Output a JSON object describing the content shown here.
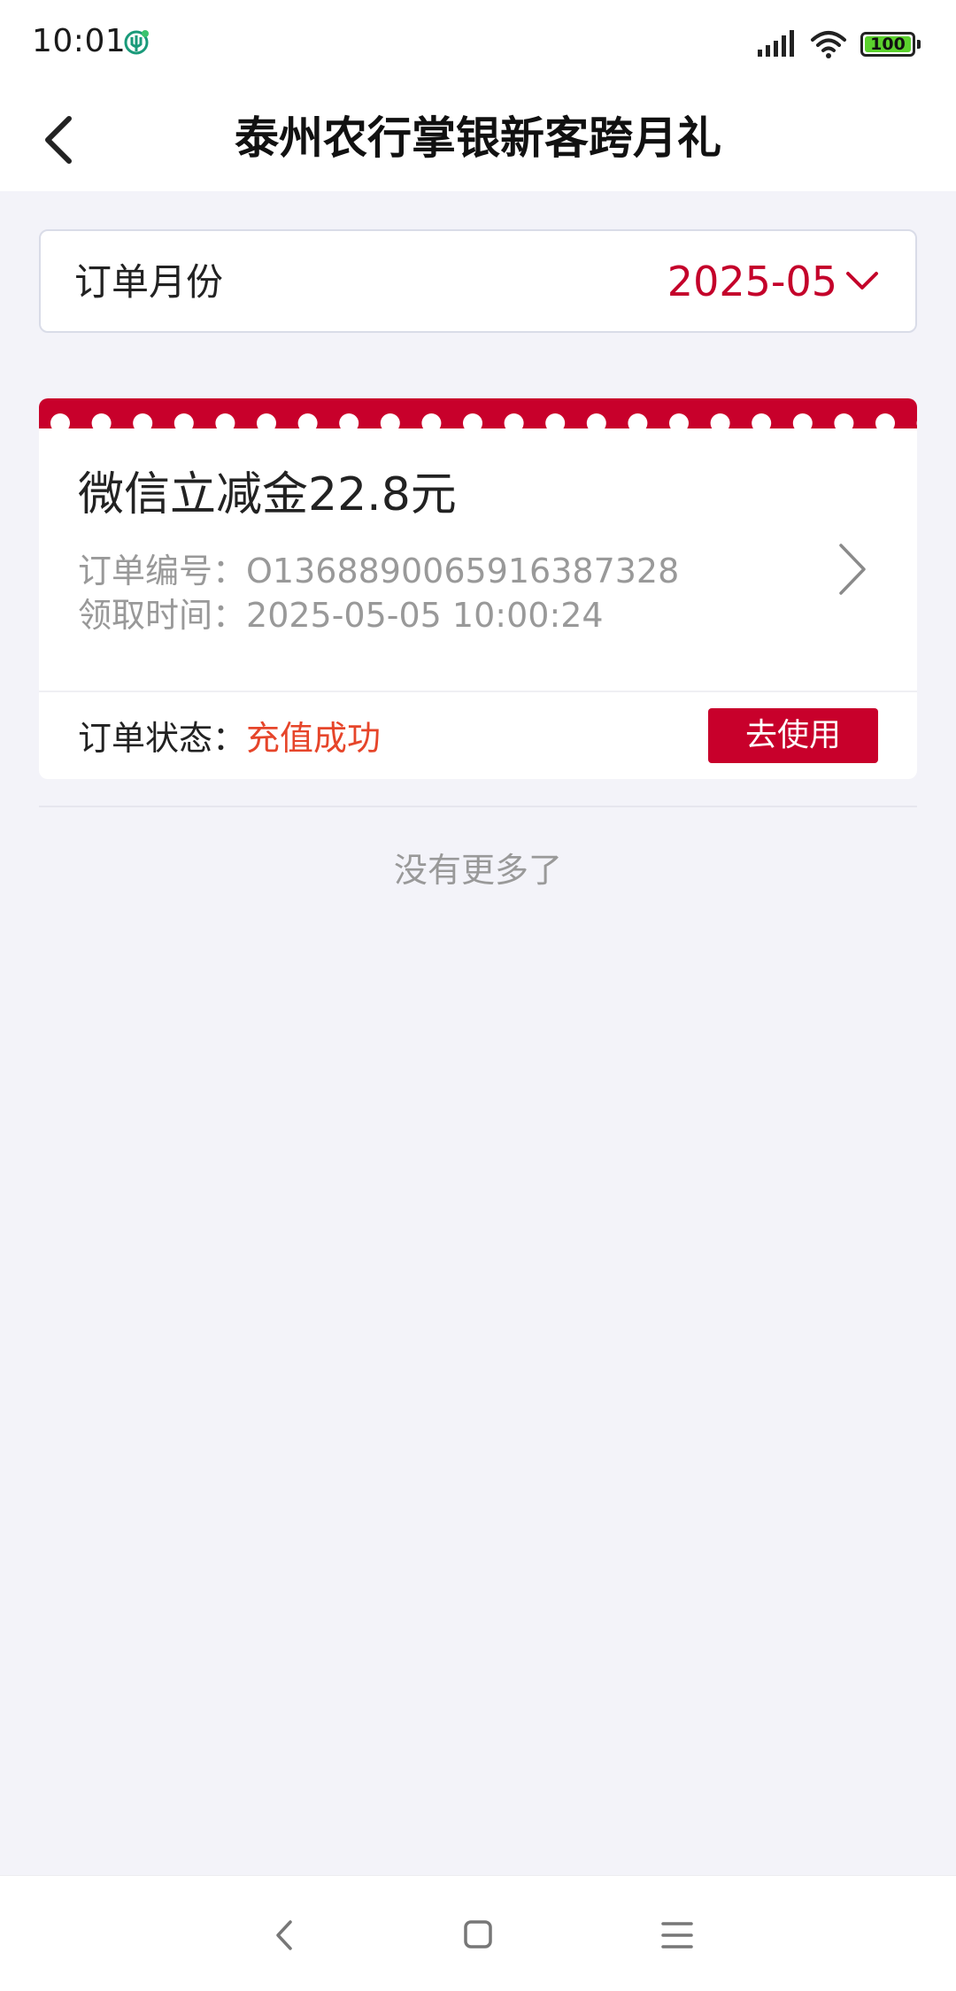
{
  "status_bar": {
    "time": "10:01",
    "battery": "100"
  },
  "header": {
    "title": "泰州农行掌银新客跨月礼"
  },
  "filter": {
    "label": "订单月份",
    "value": "2025-05"
  },
  "orders": [
    {
      "title": "微信立减金22.8元",
      "order_no_label": "订单编号：",
      "order_no": "O1368890065916387328",
      "time_label": "领取时间：",
      "time": "2025-05-05 10:00:24",
      "status_label": "订单状态：",
      "status": "充值成功",
      "action_label": "去使用"
    }
  ],
  "footer_text": "没有更多了",
  "colors": {
    "brand_red": "#c8002b",
    "status_orange": "#e6452a",
    "month_red": "#c4002a"
  }
}
